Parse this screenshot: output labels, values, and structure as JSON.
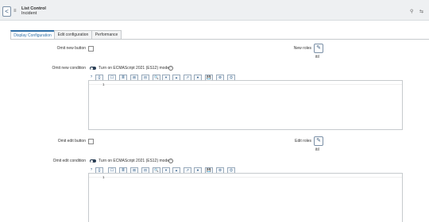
{
  "header": {
    "back_glyph": "<",
    "title_line1": "List Control",
    "title_line2": "Incident",
    "menu_glyph": "≡",
    "attach_glyph": "⚲",
    "settings_glyph": "⇆"
  },
  "tabs": [
    {
      "label": "Display Configuration",
      "active": true
    },
    {
      "label": "Edit configuration",
      "active": false
    },
    {
      "label": "Performance",
      "active": false
    }
  ],
  "form": {
    "omit_new_button_label": "Omit new button",
    "new_roles_label": "New roles",
    "new_roles_value": "itil",
    "omit_new_condition_label": "Omit new condition",
    "es_mode_label": "Turn on ECMAScript 2021 (ES12) mode",
    "editor_line_no": "1",
    "omit_edit_button_label": "Omit edit button",
    "edit_roles_label": "Edit roles",
    "edit_roles_value": "itil",
    "omit_edit_condition_label": "Omit edit condition"
  },
  "toolbar_icons": [
    "?",
    "{}",
    "☐",
    "≣",
    "⊞",
    "⊟",
    "🔍",
    "▾",
    "▴",
    "↗",
    "●",
    "💾",
    "⚙",
    "⛭"
  ]
}
